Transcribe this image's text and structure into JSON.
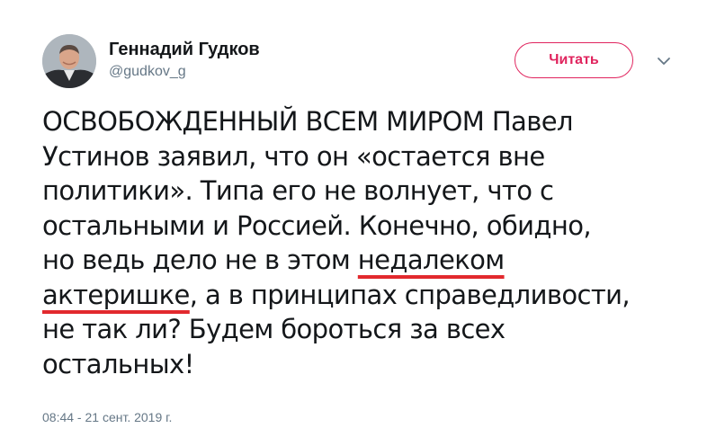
{
  "author": {
    "display_name": "Геннадий Гудков",
    "handle": "@gudkov_g",
    "avatar_icon": "profile-photo"
  },
  "follow_button": {
    "label": "Читать",
    "accent_color": "#e0245e"
  },
  "menu": {
    "icon": "chevron-down-icon"
  },
  "tweet": {
    "lines": [
      "ОСВОБОЖДЕННЫЙ ВСЕМ МИРОМ Павел",
      "Устинов заявил, что он «остается вне",
      "политики». Типа его не волнует, что с",
      "остальными и Россией. Конечно, обидно,"
    ],
    "line5_before": "но ведь дело не в этом ",
    "line5_underlined": "недалеком",
    "line6_underlined": "актеришке",
    "line6_after": ", а в принципах справедливости,",
    "lines_end": [
      "не так ли? Будем бороться за всех",
      "остальных!"
    ],
    "underline_color": "#e2292e"
  },
  "timestamp": "08:44 - 21 сент. 2019 г."
}
